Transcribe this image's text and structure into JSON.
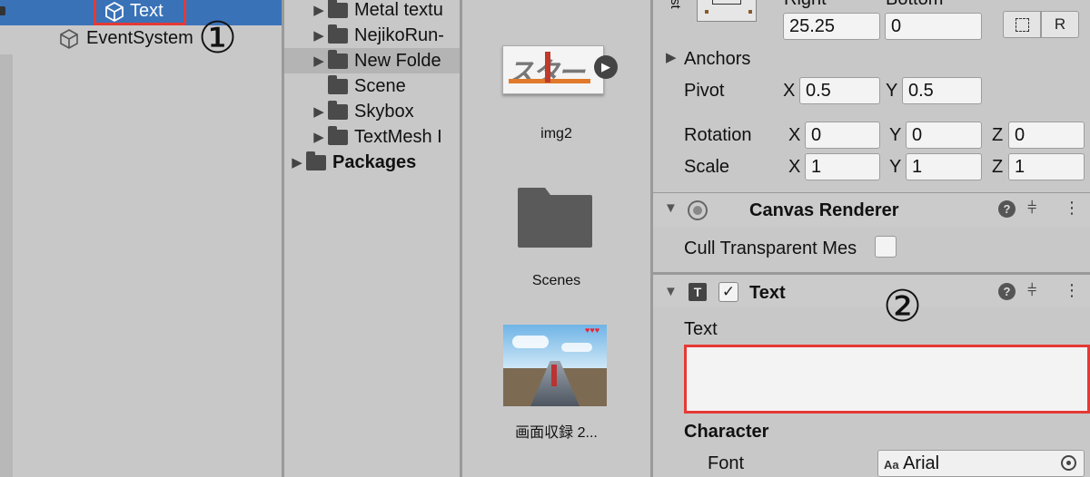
{
  "hierarchy": {
    "items": [
      {
        "label": "Text",
        "selected": true
      },
      {
        "label": "EventSystem",
        "selected": false
      }
    ],
    "annotation": "①"
  },
  "project": {
    "folders": [
      {
        "label": "Metal textu",
        "expandable": true
      },
      {
        "label": "NejikoRun-",
        "expandable": true
      },
      {
        "label": "New Folde",
        "expandable": true,
        "highlighted": true
      },
      {
        "label": "Scene",
        "expandable": false
      },
      {
        "label": "Skybox",
        "expandable": true
      },
      {
        "label": "TextMesh I",
        "expandable": true
      },
      {
        "label": "Packages",
        "expandable": true,
        "bold": true
      }
    ]
  },
  "assets": {
    "items": [
      {
        "label": "img2",
        "thumbnail_text": "スター"
      },
      {
        "label": "Scenes"
      },
      {
        "label": "画面収録 2..."
      }
    ]
  },
  "inspector": {
    "rect": {
      "right_label": "Right",
      "bottom_label": "Bottom",
      "right_value": "25.25",
      "bottom_value": "0",
      "side_label": "st",
      "r_button": "R"
    },
    "anchors_label": "Anchors",
    "pivot": {
      "label": "Pivot",
      "x": "0.5",
      "y": "0.5"
    },
    "rotation": {
      "label": "Rotation",
      "x": "0",
      "y": "0",
      "z": "0"
    },
    "scale": {
      "label": "Scale",
      "x": "1",
      "y": "1",
      "z": "1"
    },
    "axes": {
      "x": "X",
      "y": "Y",
      "z": "Z"
    },
    "canvas_renderer": {
      "title": "Canvas Renderer",
      "cull_label": "Cull Transparent Mes"
    },
    "text_component": {
      "title": "Text",
      "icon_letter": "T",
      "text_label": "Text",
      "text_value": "",
      "character_label": "Character",
      "font_label": "Font",
      "font_value": "Arial",
      "font_prefix": "Aa"
    },
    "annotation": "②"
  },
  "colors": {
    "selection": "#3a72b8",
    "annotation": "#e53935",
    "panel": "#c8c8c8"
  }
}
